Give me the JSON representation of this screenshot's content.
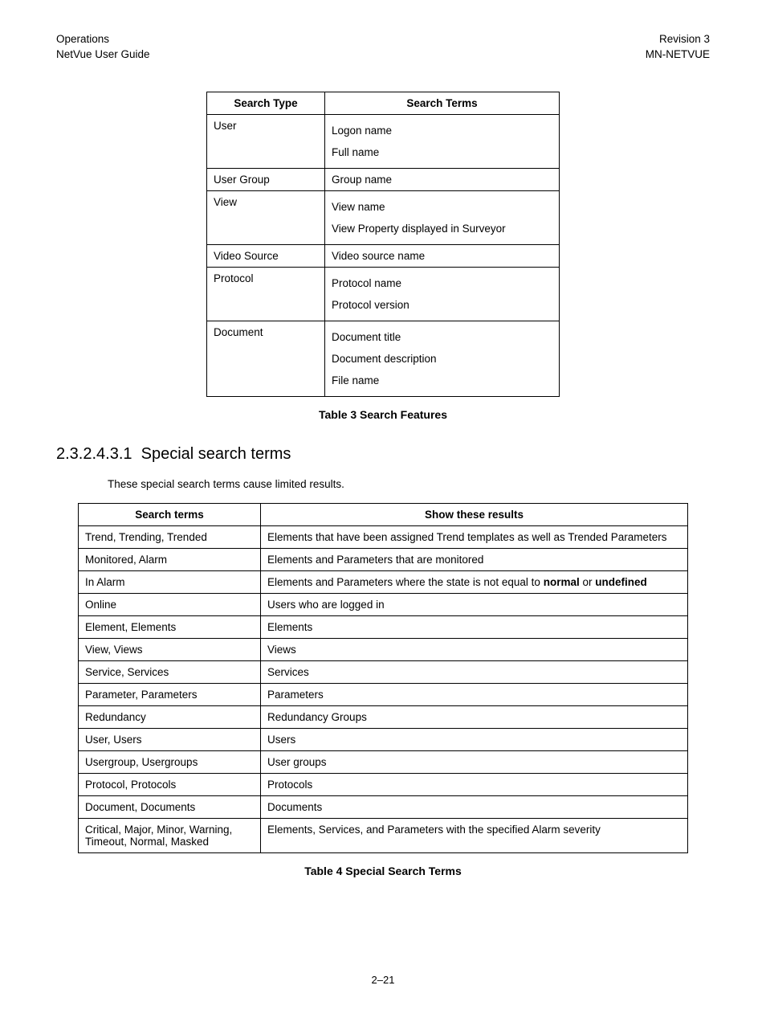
{
  "header": {
    "left1": "Operations",
    "left2": "NetVue User Guide",
    "right1": "Revision 3",
    "right2": "MN-NETVUE"
  },
  "table3": {
    "headers": [
      "Search Type",
      "Search Terms"
    ],
    "rows": [
      {
        "type": "User",
        "terms": [
          "Logon name",
          "Full name"
        ]
      },
      {
        "type": "User Group",
        "terms": [
          "Group name"
        ]
      },
      {
        "type": "View",
        "terms": [
          "View name",
          "View Property displayed in Surveyor"
        ]
      },
      {
        "type": "Video Source",
        "terms": [
          "Video source name"
        ]
      },
      {
        "type": "Protocol",
        "terms": [
          "Protocol name",
          "Protocol version"
        ]
      },
      {
        "type": "Document",
        "terms": [
          "Document title",
          "Document description",
          "File name"
        ]
      }
    ],
    "caption": "Table 3 Search Features"
  },
  "section": {
    "number": "2.3.2.4.3.1",
    "title": "Special search terms",
    "intro": "These special search terms cause limited results."
  },
  "table4": {
    "headers": [
      "Search terms",
      "Show these results"
    ],
    "rows": [
      {
        "terms": "Trend, Trending, Trended",
        "results_plain": "Elements that have been assigned Trend templates as well as Trended Parameters"
      },
      {
        "terms": "Monitored, Alarm",
        "results_plain": "Elements and Parameters that are monitored"
      },
      {
        "terms": "In Alarm",
        "results_pre": "Elements and Parameters where the state is not equal to ",
        "bold1": "normal",
        "mid": " or ",
        "bold2": "undefined"
      },
      {
        "terms": "Online",
        "results_plain": "Users who are logged in"
      },
      {
        "terms": "Element, Elements",
        "results_plain": "Elements"
      },
      {
        "terms": "View, Views",
        "results_plain": "Views"
      },
      {
        "terms": "Service, Services",
        "results_plain": "Services"
      },
      {
        "terms": "Parameter, Parameters",
        "results_plain": "Parameters"
      },
      {
        "terms": "Redundancy",
        "results_plain": "Redundancy Groups"
      },
      {
        "terms": "User, Users",
        "results_plain": "Users"
      },
      {
        "terms": "Usergroup, Usergroups",
        "results_plain": "User groups"
      },
      {
        "terms": "Protocol, Protocols",
        "results_plain": "Protocols"
      },
      {
        "terms": "Document, Documents",
        "results_plain": "Documents"
      },
      {
        "terms": "Critical, Major, Minor, Warning, Timeout, Normal, Masked",
        "results_plain": "Elements, Services, and Parameters with the specified Alarm severity"
      }
    ],
    "caption": "Table 4 Special Search Terms"
  },
  "page_number": "2–21"
}
